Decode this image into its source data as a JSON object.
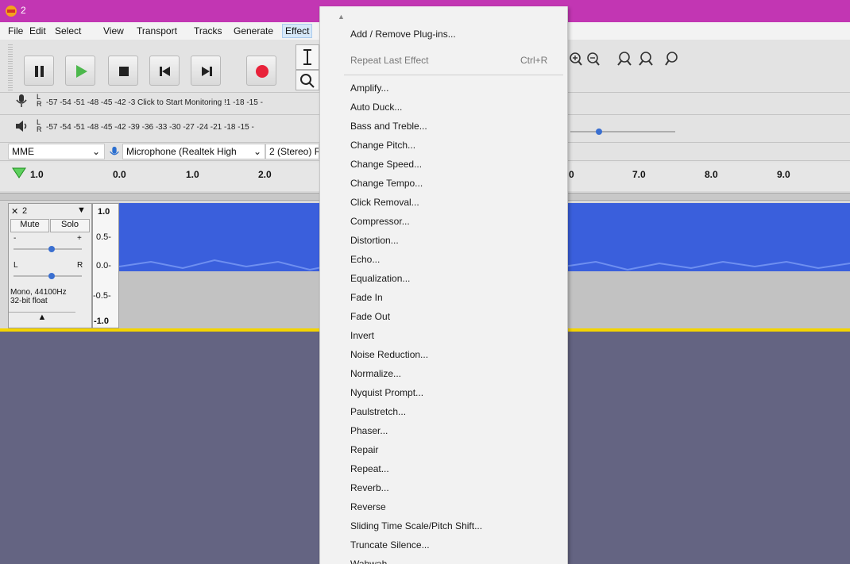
{
  "window": {
    "title": "2"
  },
  "menubar": {
    "items": [
      "File",
      "Edit",
      "Select",
      "View",
      "Transport",
      "Tracks",
      "Generate",
      "Effect"
    ]
  },
  "meters": {
    "record_scale": "-57 -54 -51 -48 -45 -42 -3 Click to Start Monitoring !1 -18 -15 -",
    "play_scale": "-57 -54 -51 -48 -45 -42 -39 -36 -33 -30 -27 -24 -21 -18 -15 -",
    "lr_left": "L",
    "lr_right": "R"
  },
  "device": {
    "host": "MME",
    "input": "Microphone (Realtek High",
    "channels": "2 (Stereo) R"
  },
  "timeline": {
    "labels_left": [
      "1.0",
      "0.0",
      "1.0",
      "2.0"
    ],
    "labels_right": [
      "0",
      "7.0",
      "8.0",
      "9.0"
    ]
  },
  "track": {
    "name": "2",
    "mute_label": "Mute",
    "solo_label": "Solo",
    "gain_minus": "-",
    "gain_plus": "+",
    "pan_l": "L",
    "pan_r": "R",
    "info_line1": "Mono, 44100Hz",
    "info_line2": "32-bit float",
    "vruler": [
      "1.0",
      "0.5-",
      "0.0-",
      "-0.5-",
      "-1.0"
    ]
  },
  "effect_menu": {
    "items": [
      {
        "label": "Add / Remove Plug-ins...",
        "enabled": true
      },
      {
        "label": "Repeat Last Effect",
        "shortcut": "Ctrl+R",
        "enabled": false
      },
      {
        "label": "Amplify...",
        "enabled": true
      },
      {
        "label": "Auto Duck...",
        "enabled": true
      },
      {
        "label": "Bass and Treble...",
        "enabled": true
      },
      {
        "label": "Change Pitch...",
        "enabled": true
      },
      {
        "label": "Change Speed...",
        "enabled": true
      },
      {
        "label": "Change Tempo...",
        "enabled": true
      },
      {
        "label": "Click Removal...",
        "enabled": true
      },
      {
        "label": "Compressor...",
        "enabled": true
      },
      {
        "label": "Distortion...",
        "enabled": true
      },
      {
        "label": "Echo...",
        "enabled": true
      },
      {
        "label": "Equalization...",
        "enabled": true
      },
      {
        "label": "Fade In",
        "enabled": true
      },
      {
        "label": "Fade Out",
        "enabled": true
      },
      {
        "label": "Invert",
        "enabled": true
      },
      {
        "label": "Noise Reduction...",
        "enabled": true
      },
      {
        "label": "Normalize...",
        "enabled": true
      },
      {
        "label": "Nyquist Prompt...",
        "enabled": true
      },
      {
        "label": "Paulstretch...",
        "enabled": true
      },
      {
        "label": "Phaser...",
        "enabled": true
      },
      {
        "label": "Repair",
        "enabled": true
      },
      {
        "label": "Repeat...",
        "enabled": true
      },
      {
        "label": "Reverb...",
        "enabled": true
      },
      {
        "label": "Reverse",
        "enabled": true
      },
      {
        "label": "Sliding Time Scale/Pitch Shift...",
        "enabled": true
      },
      {
        "label": "Truncate Silence...",
        "enabled": true
      },
      {
        "label": "Wahwah...",
        "enabled": true
      }
    ]
  },
  "colors": {
    "titlebar": "#c236b3",
    "waveform": "#3a5fdc",
    "record": "#e8223a",
    "play": "#4cb84c"
  }
}
